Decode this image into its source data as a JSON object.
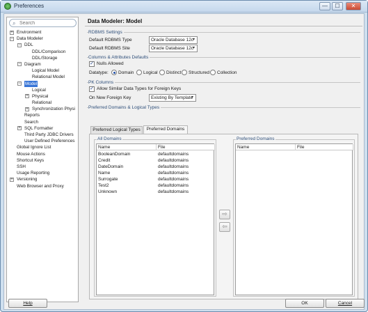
{
  "window": {
    "title": "Preferences",
    "minimize": "—",
    "maximize": "☐",
    "close": "✕"
  },
  "search": {
    "placeholder": "Search"
  },
  "tree": [
    {
      "label": "Environment",
      "toggle": "+",
      "level": 0
    },
    {
      "label": "Data Modeler",
      "toggle": "−",
      "level": 0
    },
    {
      "label": "DDL",
      "toggle": "−",
      "level": 1
    },
    {
      "label": "DDL/Comparison",
      "toggle": "",
      "level": 2
    },
    {
      "label": "DDL/Storage",
      "toggle": "",
      "level": 2
    },
    {
      "label": "Diagram",
      "toggle": "−",
      "level": 1
    },
    {
      "label": "Logical Model",
      "toggle": "",
      "level": 2
    },
    {
      "label": "Relational Model",
      "toggle": "",
      "level": 2
    },
    {
      "label": "Model",
      "toggle": "−",
      "level": 1,
      "selected": true
    },
    {
      "label": "Logical",
      "toggle": "",
      "level": 2
    },
    {
      "label": "Physical",
      "toggle": "+",
      "level": 2
    },
    {
      "label": "Relational",
      "toggle": "",
      "level": 2
    },
    {
      "label": "Synchronization Physi",
      "toggle": "+",
      "level": 2
    },
    {
      "label": "Reports",
      "toggle": "",
      "level": 1
    },
    {
      "label": "Search",
      "toggle": "",
      "level": 1
    },
    {
      "label": "SQL Formatter",
      "toggle": "+",
      "level": 1
    },
    {
      "label": "Third Party JDBC Drivers",
      "toggle": "",
      "level": 1
    },
    {
      "label": "User Defined Preferences",
      "toggle": "",
      "level": 1
    },
    {
      "label": "Global Ignore List",
      "toggle": "",
      "level": 0
    },
    {
      "label": "Mouse Actions",
      "toggle": "",
      "level": 0
    },
    {
      "label": "Shortcut Keys",
      "toggle": "",
      "level": 0
    },
    {
      "label": "SSH",
      "toggle": "",
      "level": 0
    },
    {
      "label": "Usage Reporting",
      "toggle": "",
      "level": 0
    },
    {
      "label": "Versioning",
      "toggle": "+",
      "level": 0
    },
    {
      "label": "Web Browser and Proxy",
      "toggle": "",
      "level": 0
    }
  ],
  "page": {
    "title": "Data Modeler: Model"
  },
  "rdbms": {
    "section": "RDBMS Settings",
    "type_label": "Default RDBMS Type",
    "type_value": "Oracle Database 12c",
    "site_label": "Default RDBMS Site",
    "site_value": "Oracle Database 12c"
  },
  "columns": {
    "section": "Columns & Attributes Defaults",
    "nulls_allowed": "Nulls Allowed",
    "datatype_label": "Datatype:",
    "options": [
      "Domain",
      "Logical",
      "Distinct",
      "Structured",
      "Collection"
    ],
    "selected": "Domain"
  },
  "pk": {
    "section": "PK Columns",
    "allow_similar": "Allow Similar Data Types for Foreign Keys",
    "fk_label": "On New Foreign Key",
    "fk_value": "Existing By Template"
  },
  "preferred": {
    "section": "Preferred Domains & Logical Types",
    "tabs": [
      "Preferred Logical Types",
      "Preferred Domains"
    ],
    "active_tab": "Preferred Domains",
    "all_title": "All Domains",
    "pref_title": "Preferred Domains",
    "columns": [
      "Name",
      "File"
    ],
    "all_rows": [
      {
        "name": "BooleanDomain",
        "file": "defaultdomains"
      },
      {
        "name": "Credit",
        "file": "defaultdomains"
      },
      {
        "name": "DateDomain",
        "file": "defaultdomains"
      },
      {
        "name": "Name",
        "file": "defaultdomains"
      },
      {
        "name": "Surrogate",
        "file": "defaultdomains"
      },
      {
        "name": "Test2",
        "file": "defaultdomains"
      },
      {
        "name": "Unknown",
        "file": "defaultdomains"
      }
    ],
    "pref_rows": [],
    "move_right": "⇨",
    "move_left": "⇦"
  },
  "buttons": {
    "help": "Help",
    "ok": "OK",
    "cancel": "Cancel"
  }
}
